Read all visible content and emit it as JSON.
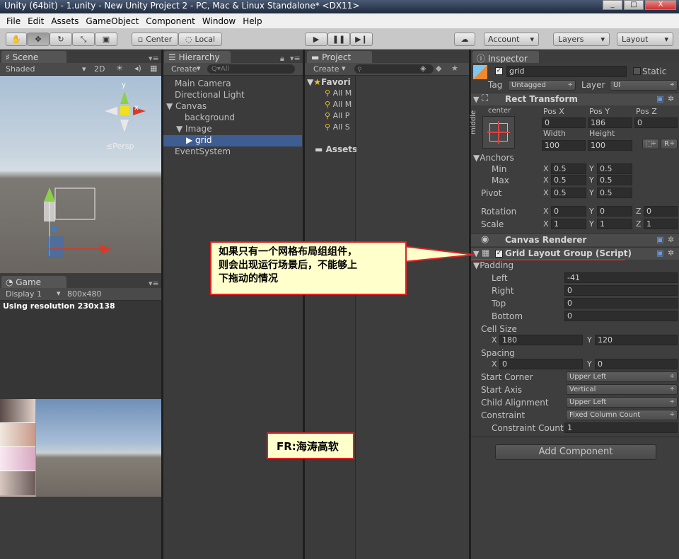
{
  "window": {
    "title": "Unity (64bit) - 1.unity - New Unity Project 2 - PC, Mac & Linux Standalone* <DX11>",
    "min": "_",
    "max": "□",
    "close": "X"
  },
  "menu": [
    "File",
    "Edit",
    "Assets",
    "GameObject",
    "Component",
    "Window",
    "Help"
  ],
  "toolbar": {
    "center": "Center",
    "local": "Local",
    "account": "Account",
    "layers": "Layers",
    "layout": "Layout"
  },
  "scene": {
    "tab": "Scene",
    "shaded": "Shaded",
    "mode2d": "2D",
    "persp": "≤Persp",
    "y": "y",
    "x": "x"
  },
  "game": {
    "tab": "Game",
    "display": "Display 1",
    "resolution": "800x480",
    "using": "Using resolution 230x138"
  },
  "hierarchy": {
    "tab": "Hierarchy",
    "create": "Create",
    "search_placeholder": "Q▾All",
    "items": [
      "Main Camera",
      "Directional Light",
      "Canvas",
      "background",
      "Image",
      "grid",
      "EventSystem"
    ]
  },
  "project": {
    "tab": "Project",
    "create": "Create",
    "favorites": "Favori",
    "fav_items": [
      "All M",
      "All M",
      "All P",
      "All S"
    ],
    "assets": "Assets"
  },
  "inspector": {
    "tab": "Inspector",
    "name": "grid",
    "static": "Static",
    "tag_label": "Tag",
    "tag": "Untagged",
    "layer_label": "Layer",
    "layer": "UI",
    "rect": {
      "title": "Rect Transform",
      "anchor_h": "center",
      "anchor_v": "middle",
      "posx_l": "Pos X",
      "posy_l": "Pos Y",
      "posz_l": "Pos Z",
      "posx": "0",
      "posy": "186",
      "posz": "0",
      "w_l": "Width",
      "h_l": "Height",
      "w": "100",
      "h": "100",
      "r": "R",
      "anchors": "Anchors",
      "min": "Min",
      "max": "Max",
      "pivot": "Pivot",
      "min_x": "0.5",
      "min_y": "0.5",
      "max_x": "0.5",
      "max_y": "0.5",
      "pivot_x": "0.5",
      "pivot_y": "0.5",
      "rotation": "Rotation",
      "scale": "Scale",
      "rx": "0",
      "ry": "0",
      "rz": "0",
      "sx": "1",
      "sy": "1",
      "sz": "1",
      "X": "X",
      "Y": "Y",
      "Z": "Z"
    },
    "canvas_renderer": "Canvas Renderer",
    "grid": {
      "title": "Grid Layout Group (Script)",
      "padding": "Padding",
      "left_l": "Left",
      "right_l": "Right",
      "top_l": "Top",
      "bottom_l": "Bottom",
      "left": "-41",
      "right": "0",
      "top": "0",
      "bottom": "0",
      "cell_size": "Cell Size",
      "cell_x": "180",
      "cell_y": "120",
      "spacing": "Spacing",
      "sp_x": "0",
      "sp_y": "0",
      "start_corner_l": "Start Corner",
      "start_corner": "Upper Left",
      "start_axis_l": "Start Axis",
      "start_axis": "Vertical",
      "child_align_l": "Child Alignment",
      "child_align": "Upper Left",
      "constraint_l": "Constraint",
      "constraint": "Fixed Column Count",
      "constraint_count_l": "Constraint Count",
      "constraint_count": "1"
    },
    "add_component": "Add Component"
  },
  "annotations": {
    "note_line1": "如果只有一个网格布局组组件，",
    "note_line2": "则会出现运行场景后，不能够上",
    "note_line3": "下拖动的情况",
    "credit": "FR:海涛高软"
  },
  "colors": {
    "selection": "#3e5d93",
    "callout_border": "#dd2222",
    "callout_bg": "#ffffcc"
  }
}
